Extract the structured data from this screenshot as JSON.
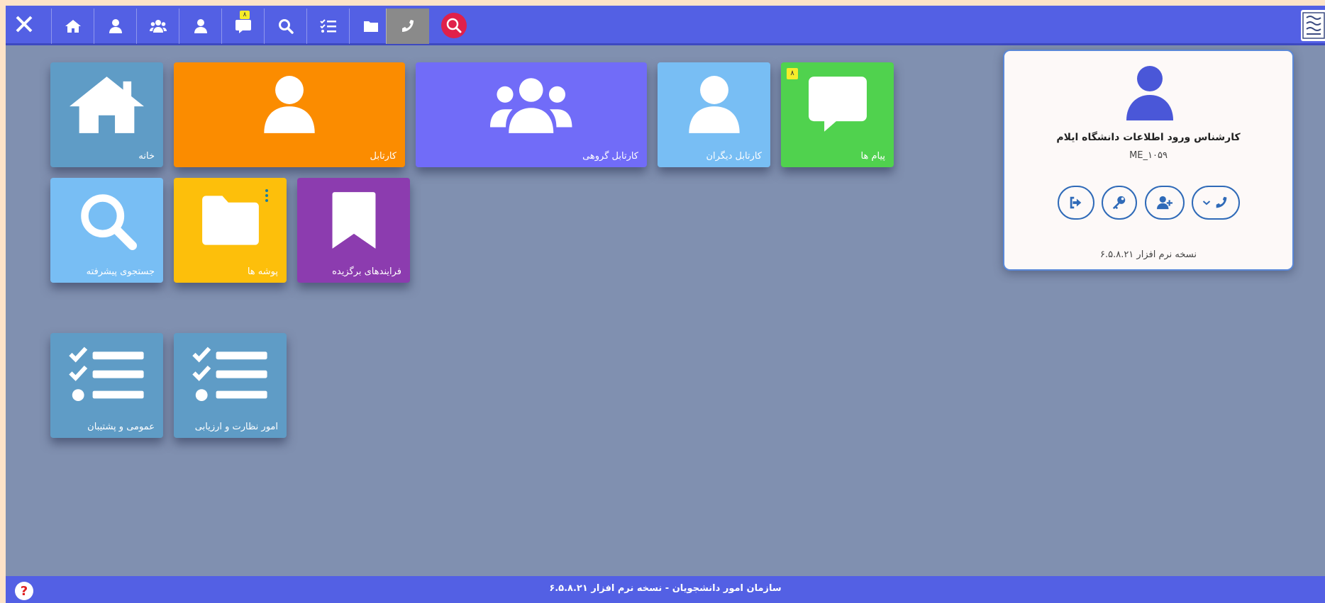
{
  "topbar": {
    "notification_badge": "۸",
    "buttons": [
      {
        "name": "close-button",
        "icon": "close-icon"
      },
      {
        "name": "home-button",
        "icon": "home-icon"
      },
      {
        "name": "user-button",
        "icon": "user-icon"
      },
      {
        "name": "group-button",
        "icon": "users-icon"
      },
      {
        "name": "other-user-button",
        "icon": "user-icon"
      },
      {
        "name": "messages-button",
        "icon": "comment-icon"
      },
      {
        "name": "search-button",
        "icon": "search-icon"
      },
      {
        "name": "tasks-button",
        "icon": "list-check-icon"
      },
      {
        "name": "folder-button",
        "icon": "folder-icon"
      },
      {
        "name": "phone-button",
        "icon": "phone-icon"
      },
      {
        "name": "global-search-button",
        "icon": "search-circle-icon"
      }
    ]
  },
  "tiles": [
    {
      "label": "خانه",
      "icon": "home-icon",
      "color": "#5f9cc6"
    },
    {
      "label": "کارتابل",
      "icon": "user-icon",
      "color": "#fb8c00"
    },
    {
      "label": "کارتابل گروهی",
      "icon": "users-icon",
      "color": "#716cf8"
    },
    {
      "label": "کارتابل دیگران",
      "icon": "user-icon",
      "color": "#78bef4"
    },
    {
      "label": "پیام ها",
      "icon": "comment-icon",
      "color": "#50d24e",
      "badge": "۸"
    },
    {
      "label": "جستجوی پیشرفته",
      "icon": "search-icon",
      "color": "#78bef4"
    },
    {
      "label": "پوشه ها",
      "icon": "folder-icon",
      "color": "#fdbf0b"
    },
    {
      "label": "فرایندهای برگزیده",
      "icon": "bookmark-icon",
      "color": "#8c3caf"
    },
    {
      "label": "عمومی و پشتیبان",
      "icon": "list-check-icon",
      "color": "#5f9cc6"
    },
    {
      "label": "امور نظارت و ارزیابی",
      "icon": "list-check-icon",
      "color": "#5f9cc6"
    }
  ],
  "profile": {
    "name": "کارشناس ورود اطلاعات دانشگاه ایلام",
    "code": "ME_۱۰۵۹",
    "version": "نسخه نرم افزار ۶.۵.۸.۲۱",
    "buttons": [
      {
        "name": "logout-button",
        "icon": "sign-out-icon"
      },
      {
        "name": "change-password-button",
        "icon": "key-icon"
      },
      {
        "name": "add-user-button",
        "icon": "user-plus-icon"
      },
      {
        "name": "phone-dropdown-button",
        "icon": "phone-icon"
      }
    ]
  },
  "footer": {
    "text": "سازمان امور دانشجویان - نسخه نرم افزار ۶.۵.۸.۲۱",
    "help": "?"
  }
}
